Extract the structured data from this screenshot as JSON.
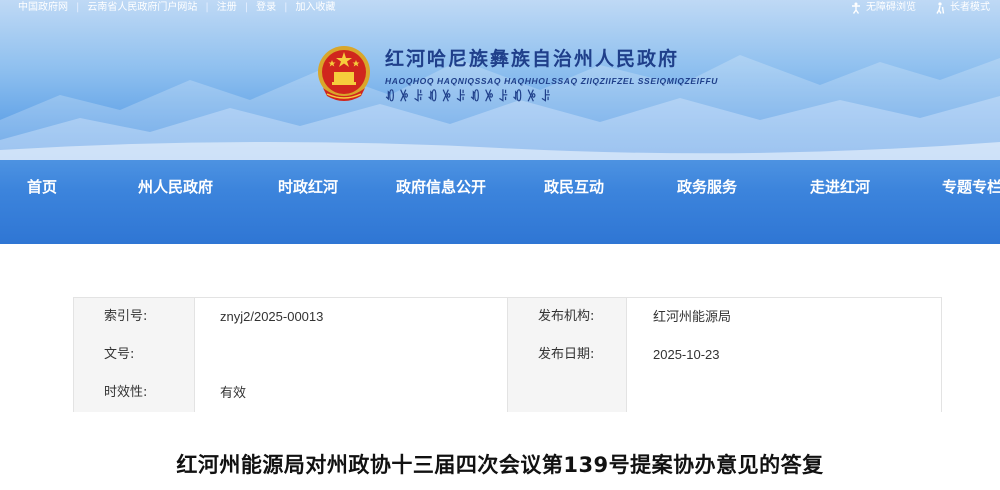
{
  "topbar": {
    "links": [
      "中国政府网",
      "云南省人民政府门户网站",
      "注册",
      "登录",
      "加入收藏"
    ],
    "accessibility_label": "无障碍浏览",
    "elder_mode_label": "长者模式",
    "icons": [
      "accessibility-icon",
      "elder-icon"
    ]
  },
  "header": {
    "title": "红河哈尼族彝族自治州人民政府",
    "pinyin": "HAOQHOQ HAQNIQSSAQ HAQHHOLSSAQ ZIIQZIIFZEL SSEIQMIQZEIFFU",
    "yi_script": "ꀒꉼꌠꀒꉼꌠꀒꉼꌠꀒꉼꌠ",
    "colors": {
      "title": "#1f3f8a",
      "banner_bottom": "#2f76d4"
    }
  },
  "nav": {
    "items": [
      "首页",
      "州人民政府",
      "时政红河",
      "政府信息公开",
      "政民互动",
      "政务服务",
      "走进红河",
      "专题专栏"
    ]
  },
  "info": {
    "rows": [
      {
        "label1": "索引号:",
        "value1": "znyj2/2025-00013",
        "label2": "发布机构:",
        "value2": "红河州能源局"
      },
      {
        "label1": "文号:",
        "value1": "",
        "label2": "发布日期:",
        "value2": "2025-10-23"
      },
      {
        "label1": "时效性:",
        "value1": "有效",
        "label2": "",
        "value2": ""
      }
    ]
  },
  "article": {
    "title": "红河州能源局对州政协十三届四次会议第139号提案协办意见的答复"
  }
}
